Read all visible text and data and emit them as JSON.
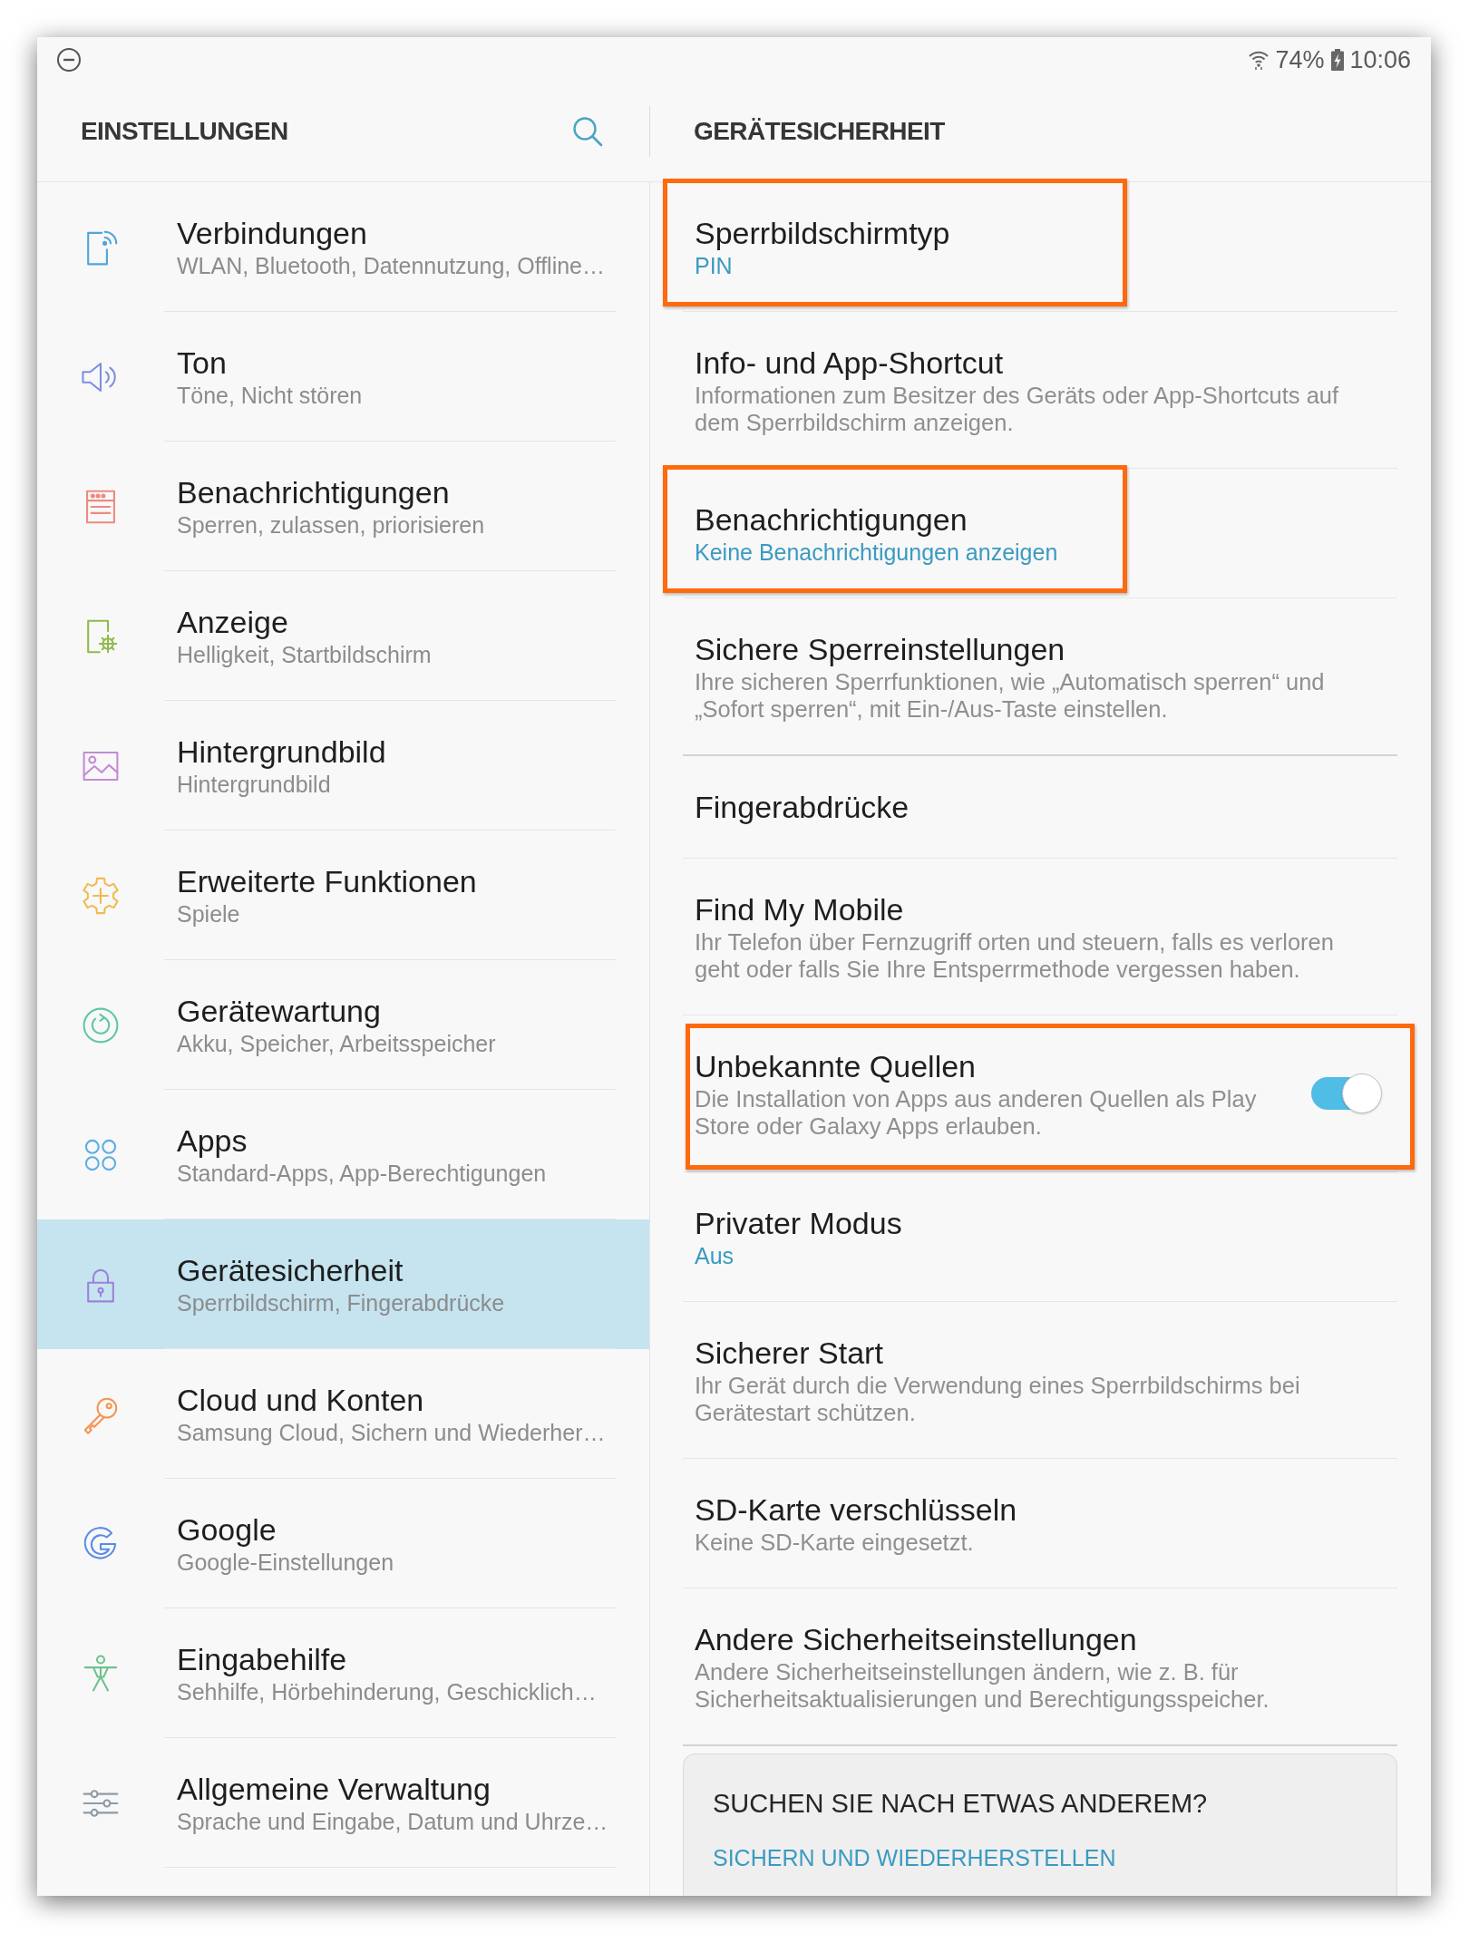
{
  "status_bar": {
    "battery": "74%",
    "time": "10:06"
  },
  "settings_panel": {
    "title": "EINSTELLUNGEN",
    "items": [
      {
        "title": "Verbindungen",
        "subtitle": "WLAN, Bluetooth, Datennutzung, Offline…",
        "selected": false
      },
      {
        "title": "Ton",
        "subtitle": "Töne, Nicht stören",
        "selected": false
      },
      {
        "title": "Benachrichtigungen",
        "subtitle": "Sperren, zulassen, priorisieren",
        "selected": false
      },
      {
        "title": "Anzeige",
        "subtitle": "Helligkeit, Startbildschirm",
        "selected": false
      },
      {
        "title": "Hintergrundbild",
        "subtitle": "Hintergrundbild",
        "selected": false
      },
      {
        "title": "Erweiterte Funktionen",
        "subtitle": "Spiele",
        "selected": false
      },
      {
        "title": "Gerätewartung",
        "subtitle": "Akku, Speicher, Arbeitsspeicher",
        "selected": false
      },
      {
        "title": "Apps",
        "subtitle": "Standard-Apps, App-Berechtigungen",
        "selected": false
      },
      {
        "title": "Gerätesicherheit",
        "subtitle": "Sperrbildschirm, Fingerabdrücke",
        "selected": true
      },
      {
        "title": "Cloud und Konten",
        "subtitle": "Samsung Cloud, Sichern und Wiederher…",
        "selected": false
      },
      {
        "title": "Google",
        "subtitle": "Google-Einstellungen",
        "selected": false
      },
      {
        "title": "Eingabehilfe",
        "subtitle": "Sehhilfe, Hörbehinderung, Geschicklich…",
        "selected": false
      },
      {
        "title": "Allgemeine Verwaltung",
        "subtitle": "Sprache und Eingabe, Datum und Uhrze…",
        "selected": false
      }
    ]
  },
  "detail": {
    "title": "GERÄTESICHERHEIT",
    "groups": [
      {
        "items": [
          {
            "title": "Sperrbildschirmtyp",
            "value": "PIN",
            "highlighted": true
          },
          {
            "title": "Info- und App-Shortcut",
            "description": "Informationen zum Besitzer des Geräts oder App-Shortcuts auf dem Sperrbildschirm anzeigen.",
            "highlighted": false
          },
          {
            "title": "Benachrichtigungen",
            "value": "Keine Benachrichtigungen anzeigen",
            "highlighted": true
          },
          {
            "title": "Sichere Sperreinstellungen",
            "description": "Ihre sicheren Sperrfunktionen, wie „Automatisch sperren“ und „Sofort sperren“, mit Ein-/Aus-Taste einstellen.",
            "highlighted": false
          }
        ]
      },
      {
        "items": [
          {
            "title": "Fingerabdrücke",
            "highlighted": false
          },
          {
            "title": "Find My Mobile",
            "description": "Ihr Telefon über Fernzugriff orten und steuern, falls es verloren geht oder falls Sie Ihre Entsperrmethode vergessen haben.",
            "highlighted": false
          },
          {
            "title": "Unbekannte Quellen",
            "description": "Die Installation von Apps aus anderen Quellen als Play Store oder Galaxy Apps erlauben.",
            "switch": {
              "on": true
            },
            "highlighted": true
          },
          {
            "title": "Privater Modus",
            "value": "Aus",
            "highlighted": false
          },
          {
            "title": "Sicherer Start",
            "description": "Ihr Gerät durch die Verwendung eines Sperrbildschirms bei Gerätestart schützen.",
            "highlighted": false
          },
          {
            "title": "SD-Karte verschlüsseln",
            "description": "Keine SD-Karte eingesetzt.",
            "highlighted": false
          },
          {
            "title": "Andere Sicherheitseinstellungen",
            "description": "Andere Sicherheitseinstellungen ändern, wie z. B. für Sicherheitsaktualisierungen und Berechtigungsspeicher.",
            "highlighted": false
          }
        ]
      }
    ],
    "suggestion_card": {
      "title": "SUCHEN SIE NACH ETWAS ANDEREM?",
      "link": "SICHERN UND WIEDERHERSTELLEN"
    }
  }
}
